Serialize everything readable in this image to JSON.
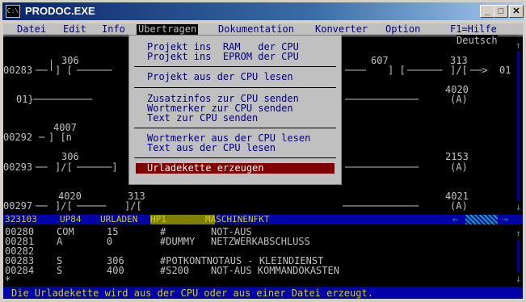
{
  "window": {
    "title": "PRODOC.EXE",
    "icon": "console-app-icon"
  },
  "title_buttons": [
    "_",
    "□",
    "✕"
  ],
  "menu": {
    "items": [
      "Datei",
      "Edit",
      "Info",
      "Übertragen",
      "Dokumentation",
      "Konverter",
      "Option"
    ],
    "help": "F1=Hilfe",
    "language": "Deutsch"
  },
  "dropdown": {
    "group1": [
      "Projekt ins  RAM   der CPU",
      "Projekt ins  EPROM der CPU"
    ],
    "group2": [
      "Projekt aus der CPU lesen"
    ],
    "group3": [
      "Zusatzinfos zur CPU senden",
      "Wortmerker zur CPU senden",
      "Text zur CPU senden"
    ],
    "group4": [
      "Wortmerker aus der CPU lesen",
      "Text aus der CPU lesen"
    ],
    "selected": "Urladekette erzeugen"
  },
  "ladder": {
    "rows": [
      {
        "num": "00283",
        "c1": "306",
        "c1_sym": "] [",
        "c2": "607",
        "c2_sym": "] [",
        "c3": "313",
        "c3_sym": "]/[",
        "out": "01"
      },
      {
        "num": "01",
        "coil": "4020",
        "coil_sym": "(A)"
      },
      {
        "num": "00292",
        "c1": "4007",
        "c1_sym": "] [n"
      },
      {
        "num": "00293",
        "c1": "306",
        "c1_sym": "]/[",
        "coil": "2153",
        "coil_sym": "(A)"
      },
      {
        "num": "00297",
        "c1": "4020",
        "c1_sym": "]/[",
        "c2": "313",
        "c2_sym": "]/[",
        "coil": "4021",
        "coil_sym": "(A)"
      }
    ]
  },
  "status_bar": {
    "id": "323103",
    "program": "UP84",
    "mode": "URLADEN",
    "hp": "HP1",
    "function": "MASCHINENFKT"
  },
  "listing": [
    [
      "00280",
      "COM",
      "15",
      "#",
      "NOT-AUS"
    ],
    [
      "00281",
      "A",
      "0",
      "#DUMMY",
      "NETZWERKABSCHLUSS"
    ],
    [
      "00282",
      "",
      "",
      "",
      ""
    ],
    [
      "00283",
      "S",
      "306",
      "#POTKONTNOTAUS - KLEINDIENST",
      ""
    ],
    [
      "00284",
      "S",
      "400",
      "#S200",
      "NOT-AUS KOMMANDOKASTEN"
    ]
  ],
  "prompt": "*",
  "message": "Die Urladekette wird aus der CPU oder aus einer Datei erzeugt."
}
